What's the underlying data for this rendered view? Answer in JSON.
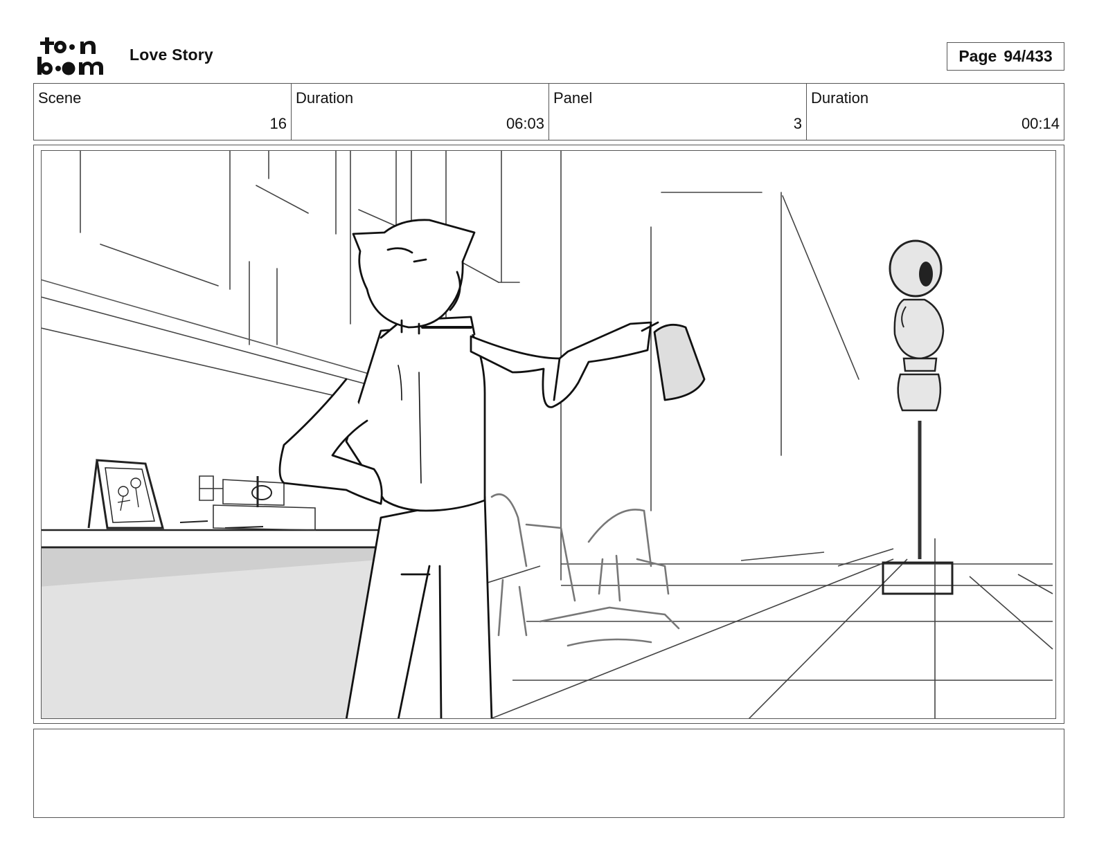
{
  "header": {
    "logo_text": "toon boom",
    "project_title": "Love Story",
    "page_label": "Page",
    "page_value": "94/433"
  },
  "info": {
    "scene_label": "Scene",
    "scene_value": "16",
    "scene_duration_label": "Duration",
    "scene_duration_value": "06:03",
    "panel_label": "Panel",
    "panel_value": "3",
    "panel_duration_label": "Duration",
    "panel_duration_value": "00:14"
  },
  "panel": {
    "image": "storyboard-sketch",
    "description_text": ""
  }
}
